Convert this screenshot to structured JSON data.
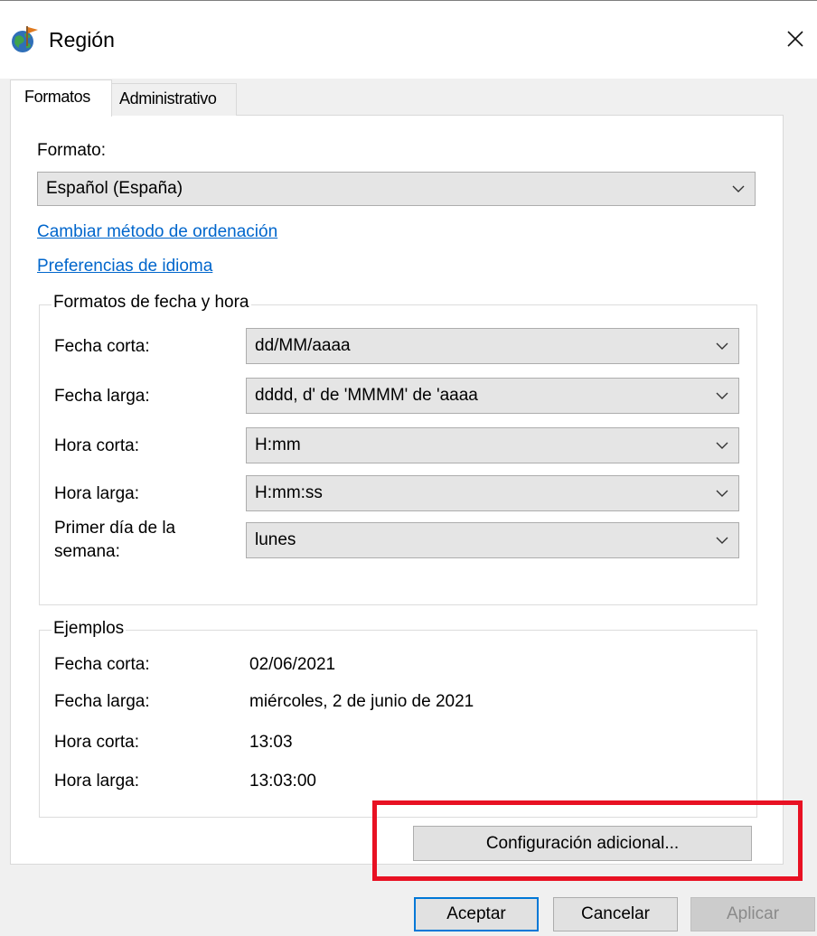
{
  "window": {
    "title": "Región",
    "icon": "globe-icon",
    "close_icon": "close-icon"
  },
  "tabs": [
    {
      "label": "Formatos",
      "active": true
    },
    {
      "label": "Administrativo",
      "active": false
    }
  ],
  "format": {
    "label": "Formato:",
    "selected": "Español (España)",
    "links": {
      "sort_method": "Cambiar método de ordenación",
      "language_prefs": "Preferencias de idioma"
    }
  },
  "date_time_formats": {
    "title": "Formatos de fecha y hora",
    "rows": [
      {
        "label": "Fecha corta:",
        "value": "dd/MM/aaaa"
      },
      {
        "label": "Fecha larga:",
        "value": "dddd, d' de 'MMMM' de 'aaaa"
      },
      {
        "label": "Hora corta:",
        "value": "H:mm"
      },
      {
        "label": "Hora larga:",
        "value": "H:mm:ss"
      },
      {
        "label_line1": "Primer día de la",
        "label_line2": "semana:",
        "value": "lunes"
      }
    ]
  },
  "examples": {
    "title": "Ejemplos",
    "rows": [
      {
        "label": "Fecha corta:",
        "value": "02/06/2021"
      },
      {
        "label": "Fecha larga:",
        "value": "miércoles, 2 de junio de 2021"
      },
      {
        "label": "Hora corta:",
        "value": "13:03"
      },
      {
        "label": "Hora larga:",
        "value": "13:03:00"
      }
    ]
  },
  "buttons": {
    "additional": "Configuración adicional...",
    "accept": "Aceptar",
    "cancel": "Cancelar",
    "apply": "Aplicar"
  },
  "colors": {
    "highlight": "#e81123",
    "link": "#0066cc",
    "default_button_border": "#0078d7"
  }
}
